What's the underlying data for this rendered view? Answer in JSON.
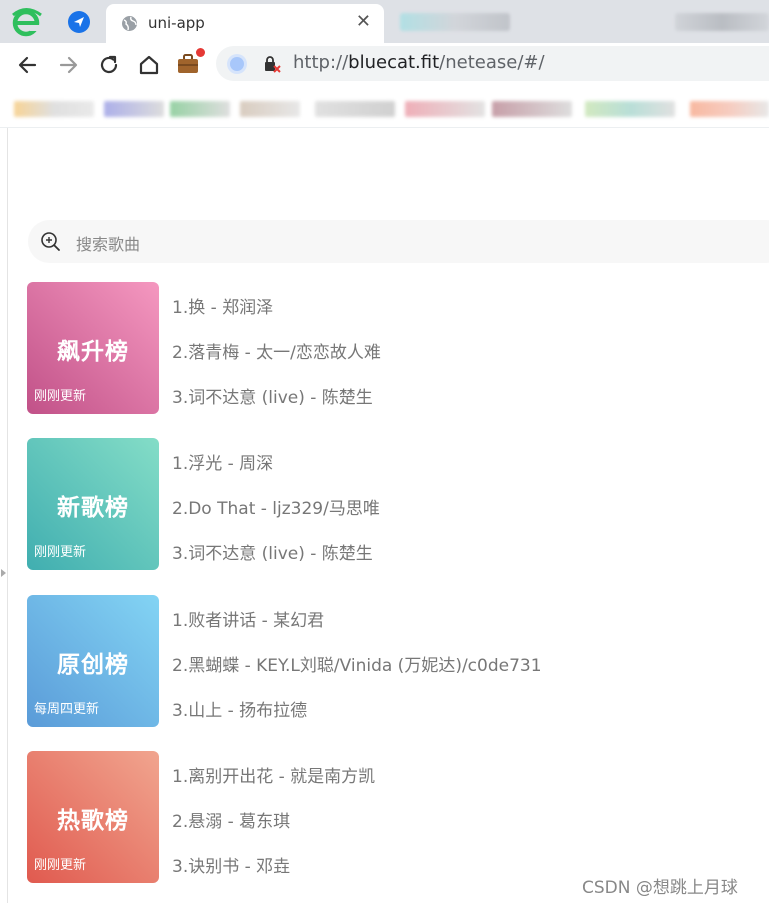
{
  "browser": {
    "tab_title": "uni-app",
    "tab_close": "✕",
    "url_scheme": "http://",
    "url_host": "bluecat.fit",
    "url_path": "/netease/#/"
  },
  "search": {
    "placeholder": "搜索歌曲"
  },
  "rankings": [
    {
      "title": "飙升榜",
      "update": "刚刚更新",
      "colors": [
        "#f598c0",
        "#c15188"
      ],
      "songs": [
        "1.换 - 郑润泽",
        "2.落青梅 - 太一/恋恋故人难",
        "3.词不达意 (live) - 陈楚生"
      ]
    },
    {
      "title": "新歌榜",
      "update": "刚刚更新",
      "colors": [
        "#84ddc7",
        "#40aeb0"
      ],
      "songs": [
        "1.浮光 - 周深",
        "2.Do That - ljz329/马思唯",
        "3.词不达意 (live) - 陈楚生"
      ]
    },
    {
      "title": "原创榜",
      "update": "每周四更新",
      "colors": [
        "#83d4f4",
        "#5a9bd8"
      ],
      "songs": [
        "1.败者讲话 - 某幻君",
        "2.黑蝴蝶 - KEY.L刘聪/Vinida (万妮达)/c0de731",
        "3.山上 - 扬布拉德"
      ]
    },
    {
      "title": "热歌榜",
      "update": "刚刚更新",
      "colors": [
        "#f1a58f",
        "#e05a4f"
      ],
      "songs": [
        "1.离别开出花 - 就是南方凯",
        "2.悬溺 - 葛东琪",
        "3.诀别书 - 邓垚"
      ]
    }
  ],
  "watermark": "CSDN @想跳上月球"
}
